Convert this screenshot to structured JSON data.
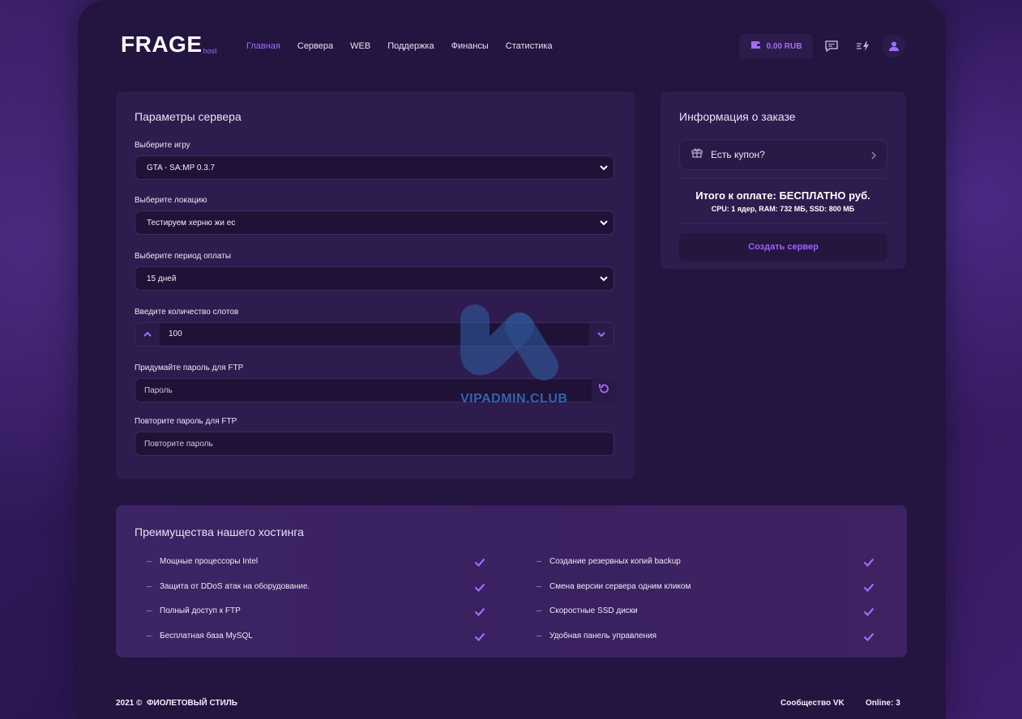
{
  "header": {
    "logo": "FRAGE",
    "logo_sub": "host",
    "nav": [
      {
        "label": "Главная",
        "active": true
      },
      {
        "label": "Сервера",
        "active": false
      },
      {
        "label": "WEB",
        "active": false
      },
      {
        "label": "Поддержка",
        "active": false
      },
      {
        "label": "Финансы",
        "active": false
      },
      {
        "label": "Статистика",
        "active": false
      }
    ],
    "balance": "0.00 RUB",
    "icons": [
      "wallet-icon",
      "chat-icon",
      "lightning-icon",
      "user-icon"
    ]
  },
  "server_params": {
    "title": "Параметры сервера",
    "game_label": "Выберите игру",
    "game_value": "GTA - SA:MP 0.3.7",
    "location_label": "Выберите локацию",
    "location_value": "Тестируем херню жи ес",
    "period_label": "Выберите период оплаты",
    "period_value": "15 дней",
    "slots_label": "Введите количество слотов",
    "slots_value": "100",
    "ftp_label": "Придумайте пароль для FTP",
    "ftp_placeholder": "Пароль",
    "ftp_repeat_label": "Повторите пароль для FTP",
    "ftp_repeat_placeholder": "Повторите пароль"
  },
  "order": {
    "title": "Информация о заказе",
    "coupon": "Есть купон?",
    "total": "Итого к оплате: БЕСПЛАТНО руб.",
    "specs": "CPU: 1 ядер, RAM: 732 МБ, SSD: 800 МБ",
    "create_button": "Создать сервер"
  },
  "features": {
    "title": "Преимущества нашего хостинга",
    "left": [
      "Мощные процессоры Intel",
      "Защита от DDoS атак на оборудование.",
      "Полный доступ к FTP",
      "Бесплатная база MySQL"
    ],
    "right": [
      "Создание резервных копий backup",
      "Смена версии сервера одним кликом",
      "Скоростные SSD диски",
      "Удобная панель управления"
    ]
  },
  "footer": {
    "copyright": "2021 ©",
    "brand": "ФИОЛЕТОВЫЙ СТИЛЬ",
    "vk": "Сообщество VK",
    "online": "Online: 3"
  },
  "watermark": "VIPADMIN.CLUB",
  "colors": {
    "accent": "#a36bff",
    "card": "#2e1c4e",
    "shell": "#231540"
  }
}
